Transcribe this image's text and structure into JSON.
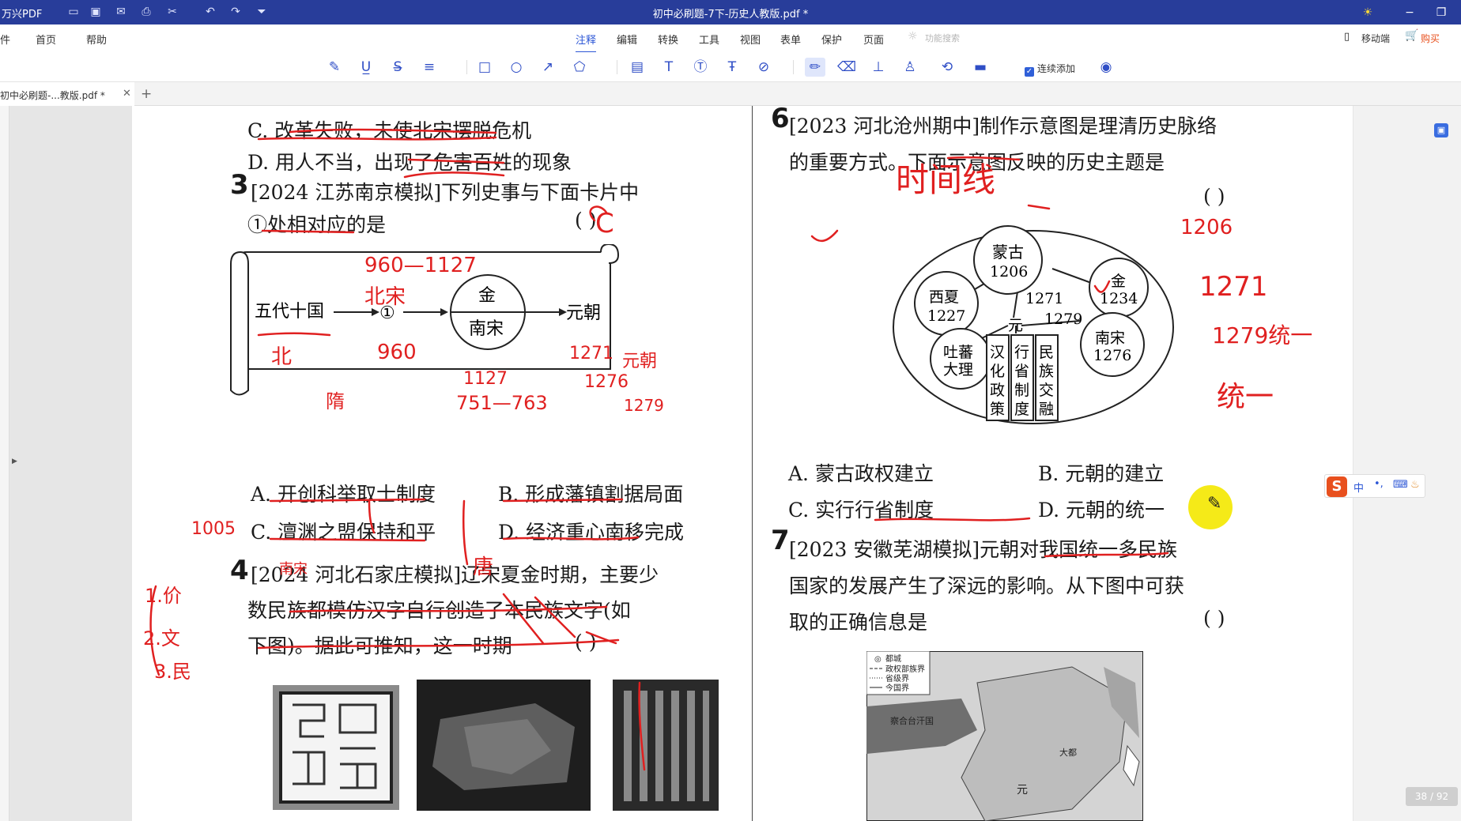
{
  "titlebar": {
    "app_name": "万兴PDF",
    "doc_title": "初中必刷题-7下-历史人教版.pdf *",
    "icons": [
      "folder-icon",
      "save-icon",
      "mail-icon",
      "print-icon",
      "cursor-icon",
      "undo-icon",
      "redo-icon",
      "dropdown-icon"
    ]
  },
  "menubar": {
    "left": [
      "件",
      "首页",
      "帮助"
    ],
    "tabs": [
      "注释",
      "编辑",
      "转换",
      "工具",
      "视图",
      "表单",
      "保护",
      "页面"
    ],
    "active_tab": "注释",
    "search_placeholder": "功能搜索",
    "mobile": "移动端",
    "buy": "购买"
  },
  "toolbar": {
    "continuous_add": "连续添加"
  },
  "doctab": {
    "name": "初中必刷题-...教版.pdf *"
  },
  "page": {
    "counter": "38 / 92",
    "q2": {
      "optC": "C. 改革失败，未使北宋摆脱危机",
      "optD": "D. 用人不当，出现了危害百姓的现象"
    },
    "q3": {
      "num": "3",
      "stem1": "[2024 江苏南京模拟]下列史事与下面卡片中",
      "stem2": "①处相对应的是",
      "paren": "(          )",
      "scroll": {
        "a": "五代十国",
        "b": "①",
        "c_top": "金",
        "c_bottom": "南宋",
        "d": "元朝"
      },
      "optA": "A. 开创科举取士制度",
      "optB": "B. 形成藩镇割据局面",
      "optC": "C. 澶渊之盟保持和平",
      "optD": "D. 经济重心南移完成"
    },
    "q4": {
      "num": "4",
      "stem1": "[2024 河北石家庄模拟]辽宋夏金时期，主要少",
      "stem2": "数民族都模仿汉字自行创造了本民族文字(如",
      "stem3": "下图)。据此可推知，这一时期",
      "paren": "(          )"
    },
    "q6": {
      "num": "6",
      "stem1": "[2023 河北沧州期中]制作示意图是理清历史脉络",
      "stem2": "的重要方式。下面示意图反映的历史主题是",
      "paren": "(          )",
      "diagram": {
        "mongol": "蒙古",
        "mongol_year": "1206",
        "xixia": "西夏",
        "xixia_year": "1227",
        "jin": "金",
        "jin_year": "1234",
        "yuan": "元",
        "year_1271": "1271",
        "year_1279": "1279",
        "tubo": "吐蕃",
        "tubo2": "大理",
        "nansong": "南宋",
        "nansong_year": "1276",
        "col1": "汉化政策",
        "col2": "行省制度",
        "col3": "民族交融"
      },
      "optA": "A. 蒙古政权建立",
      "optB": "B. 元朝的建立",
      "optC": "C. 实行行省制度",
      "optD": "D. 元朝的统一"
    },
    "q7": {
      "num": "7",
      "stem1": "[2023 安徽芜湖模拟]元朝对我国统一多民族",
      "stem2": "国家的发展产生了深远的影响。从下图中可获",
      "stem3": "取的正确信息是",
      "paren": "(          )",
      "legend": [
        "都城",
        "政权部族界",
        "省级界",
        "今国界"
      ],
      "map_labels": [
        "察合台汗国",
        "大都",
        "元"
      ]
    },
    "handwriting": [
      "960—1127",
      "北宋",
      "960",
      "北",
      "1271",
      "1127",
      "1276",
      "元朝",
      "751—763",
      "1279",
      "1005",
      "隋",
      "唐",
      "南宋",
      "1.价",
      "2.文",
      "3.民",
      "时间线",
      "1206",
      "1271",
      "1279统一",
      "统一",
      "C"
    ]
  },
  "ime": {
    "label": "中",
    "punct": "•,",
    "keyboard": "⌨",
    "skin": "♨"
  }
}
